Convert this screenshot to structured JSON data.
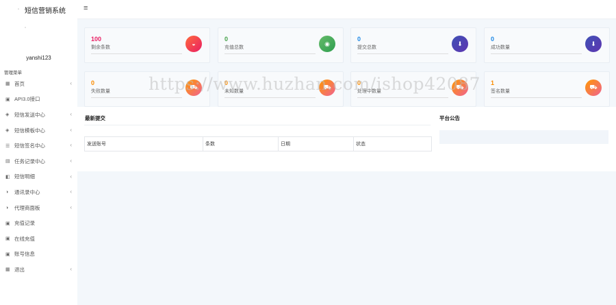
{
  "app": {
    "title": "短信营销系统",
    "username": "yanshi123"
  },
  "sidebar": {
    "header": "管理菜单",
    "items": [
      {
        "label": "首页",
        "icon": "grid-icon",
        "has_children": true
      },
      {
        "label": "API3.0接口",
        "icon": "calendar-icon",
        "has_children": false
      },
      {
        "label": "短信发送中心",
        "icon": "layers-icon",
        "has_children": true
      },
      {
        "label": "短信模板中心",
        "icon": "layers-icon",
        "has_children": true
      },
      {
        "label": "短信签名中心",
        "icon": "list-icon",
        "has_children": true
      },
      {
        "label": "任务记录中心",
        "icon": "briefcase-icon",
        "has_children": true
      },
      {
        "label": "短信明细",
        "icon": "book-icon",
        "has_children": true
      },
      {
        "label": "通讯录中心",
        "icon": "half-circle-icon",
        "has_children": true
      },
      {
        "label": "代理商面板",
        "icon": "half-circle-icon",
        "has_children": true
      },
      {
        "label": "充值记录",
        "icon": "calendar-icon",
        "has_children": false
      },
      {
        "label": "在线充值",
        "icon": "calendar-icon",
        "has_children": false
      },
      {
        "label": "账号信息",
        "icon": "calendar-icon",
        "has_children": false
      },
      {
        "label": "退出",
        "icon": "table-icon",
        "has_children": true
      }
    ]
  },
  "stats": [
    {
      "value": "100",
      "label": "剩余条数",
      "color": "#e91e63",
      "icon": "basket-icon",
      "badge": "linear-gradient(135deg,#ff6a3d,#e91e63)"
    },
    {
      "value": "0",
      "label": "充值总数",
      "color": "#43a047",
      "icon": "user-circle-icon",
      "badge": "linear-gradient(135deg,#66bb6a,#2e9e4f)"
    },
    {
      "value": "0",
      "label": "提交总数",
      "color": "#1e88e5",
      "icon": "download-icon",
      "badge": "linear-gradient(135deg,#3f51b5,#5e35b1)"
    },
    {
      "value": "0",
      "label": "成功数量",
      "color": "#1e88e5",
      "icon": "download-icon",
      "badge": "linear-gradient(135deg,#3f51b5,#5e35b1)"
    },
    {
      "value": "0",
      "label": "失败数量",
      "color": "#fb8c00",
      "icon": "cart-icon",
      "badge": "linear-gradient(135deg,#ff9800,#f06292)"
    },
    {
      "value": "0",
      "label": "未知数量",
      "color": "#fb8c00",
      "icon": "cart-icon",
      "badge": "linear-gradient(135deg,#ff9800,#f06292)"
    },
    {
      "value": "0",
      "label": "处理中数量",
      "color": "#fb8c00",
      "icon": "cart-icon",
      "badge": "linear-gradient(135deg,#ff9800,#f06292)"
    },
    {
      "value": "1",
      "label": "签名数量",
      "color": "#fb8c00",
      "icon": "cart-icon",
      "badge": "linear-gradient(135deg,#ff9800,#f06292)"
    }
  ],
  "latest": {
    "title": "最新提交",
    "columns": [
      "发送账号",
      "条数",
      "日期",
      "状态"
    ]
  },
  "notice": {
    "title": "平台公告"
  },
  "watermark": "https://www.huzhan.com/ishop42087"
}
